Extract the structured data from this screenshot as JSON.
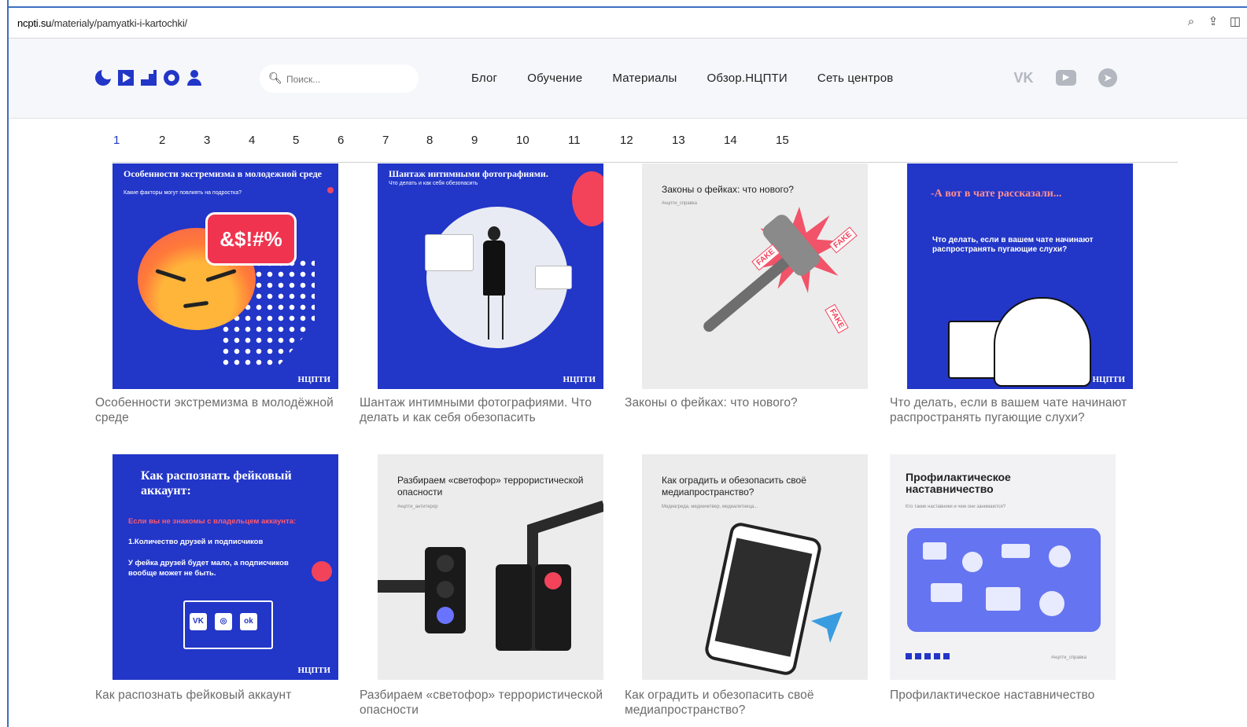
{
  "browser": {
    "url_host": "ncpti.su",
    "url_path": "/materialy/pamyatki-i-kartochki/",
    "icons": [
      "zoom-icon",
      "share-icon",
      "screenshot-icon"
    ]
  },
  "header": {
    "logo_icons": [
      "crescent-icon",
      "play-icon",
      "steps-icon",
      "ring-icon",
      "person-icon"
    ],
    "search_placeholder": "Поиск...",
    "nav": [
      "Блог",
      "Обучение",
      "Материалы",
      "Обзор.НЦПТИ",
      "Сеть центров"
    ],
    "socials": [
      "vk-icon",
      "youtube-icon",
      "telegram-icon"
    ],
    "social_glyphs": {
      "vk": "VK",
      "yt": "▶",
      "tg": "➤"
    }
  },
  "pagination": {
    "pages": [
      "1",
      "2",
      "3",
      "4",
      "5",
      "6",
      "7",
      "8",
      "9",
      "10",
      "11",
      "12",
      "13",
      "14",
      "15"
    ],
    "active": "1"
  },
  "cards": [
    {
      "title": "Особенности экстремизма в молодёжной среде",
      "image_heading": "Особенности экстремизма в молодежной среде",
      "image_sub": "Какие факторы могут повлиять на подростка?",
      "image_text": "&$!#%",
      "brand": "НЦПТИ"
    },
    {
      "title": "Шантаж интимными фотографиями. Что делать и как себя обезопасить",
      "image_heading": "Шантаж интимными фотографиями.",
      "image_sub": "Что делать и как себя обезопасить",
      "brand": "НЦПТИ"
    },
    {
      "title": "Законы о фейках: что нового?",
      "image_heading": "Законы о фейках: что нового?",
      "image_sub": "#нцпти_справка",
      "tags": [
        "FAKE",
        "FAKE",
        "FAKE"
      ]
    },
    {
      "title": "Что делать, если в вашем чате начинают распространять пугающие слухи?",
      "image_heading": "-А вот в чате рассказали...",
      "image_sub": "Что делать, если в вашем чате начинают распространять пугающие слухи?",
      "brand": "НЦПТИ"
    },
    {
      "title": "Как распознать фейковый аккаунт",
      "image_heading": "Как распознать фейковый аккаунт:",
      "image_red": "Если вы не знакомы с владельцем аккаунта:",
      "image_l1": "1.Количество друзей и подписчиков",
      "image_l2": "У фейка друзей будет мало, а подписчиков вообще может не быть.",
      "image_icons": [
        "VK",
        "◎",
        "ok"
      ],
      "brand": "НЦПТИ"
    },
    {
      "title": "Разбираем «светофор» террористической опасности",
      "image_heading": "Разбираем «светофор» террористической опасности",
      "image_sub": "#нцпти_антитерор"
    },
    {
      "title": "Как оградить и обезопасить своё медиапространство?",
      "image_heading": "Как оградить и обезопасить своё медиапространство?",
      "image_sub": "Медиагреда, медиачетвер, медиалетница..."
    },
    {
      "title": "Профилактическое наставничество",
      "image_heading": "Профилактическое наставничество",
      "image_sub": "Кто такие наставники и чем они занимаются?",
      "image_footer": "#нцпти_справка"
    }
  ]
}
